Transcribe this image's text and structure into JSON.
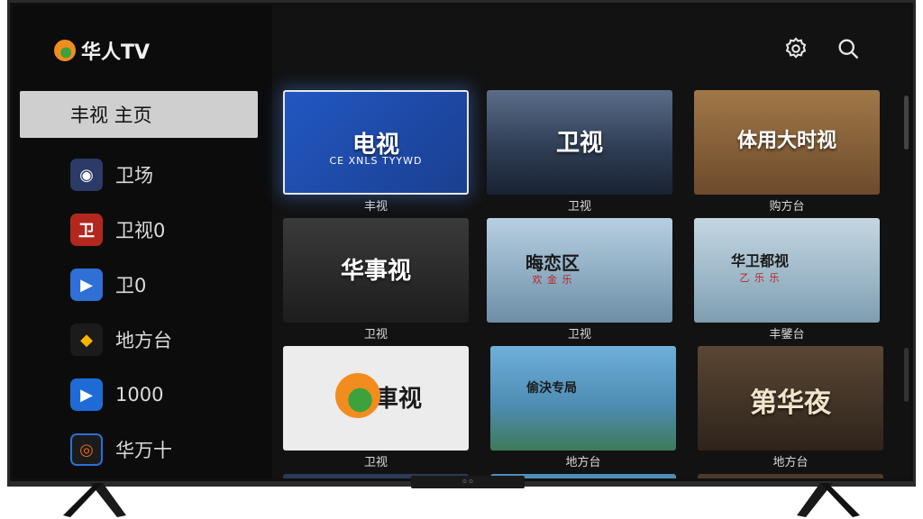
{
  "app": {
    "name": "华人TV"
  },
  "sidebar": {
    "active_label": "丰视 主页",
    "items": [
      {
        "label": "卫场",
        "icon": "cctv-icon",
        "color": "#2b3a67"
      },
      {
        "label": "卫视0",
        "icon": "wei-icon",
        "color": "#b2281f"
      },
      {
        "label": "卫0",
        "icon": "play-icon",
        "color": "#2f6fd6"
      },
      {
        "label": "地方台",
        "icon": "pin-icon",
        "color": "#1b1b1b"
      },
      {
        "label": "1000",
        "icon": "play-icon",
        "color": "#1f6bd6"
      },
      {
        "label": "华万十",
        "icon": "ring-icon",
        "color": "#1b1b1b"
      }
    ]
  },
  "toolbar": {
    "settings_icon": "gear-icon",
    "search_icon": "search-icon"
  },
  "cards": [
    {
      "title": "电视",
      "subtitle": "CE XNLS TYYWD",
      "caption": "丰视",
      "bg": "#1f4fb2"
    },
    {
      "title": "卫视",
      "subtitle": "",
      "caption": "卫视",
      "bg": "#3b4a66"
    },
    {
      "title": "体用大时视",
      "subtitle": "",
      "caption": "购方台",
      "bg": "#8a6a4a"
    },
    {
      "title": "华事视",
      "subtitle": "",
      "caption": "卫视",
      "bg": "#2b2b2b"
    },
    {
      "title": "晦恋区",
      "subtitle": "欢 金 乐",
      "caption": "卫视",
      "bg": "#8fb0c8"
    },
    {
      "title": "华卫都视",
      "subtitle": "乙 乐 乐",
      "caption": "丰鐾台",
      "bg": "#9ab7c9"
    },
    {
      "title": "車视",
      "subtitle": "",
      "caption": "卫视",
      "bg": "#e9e9e9"
    },
    {
      "title": "偷決专局",
      "subtitle": "",
      "caption": "地方台",
      "bg": "#5ea0c8"
    },
    {
      "title": "第华夜",
      "subtitle": "",
      "caption": "地方台",
      "bg": "#4a3a2e"
    }
  ],
  "bezel_text": "⊙ ⊙"
}
